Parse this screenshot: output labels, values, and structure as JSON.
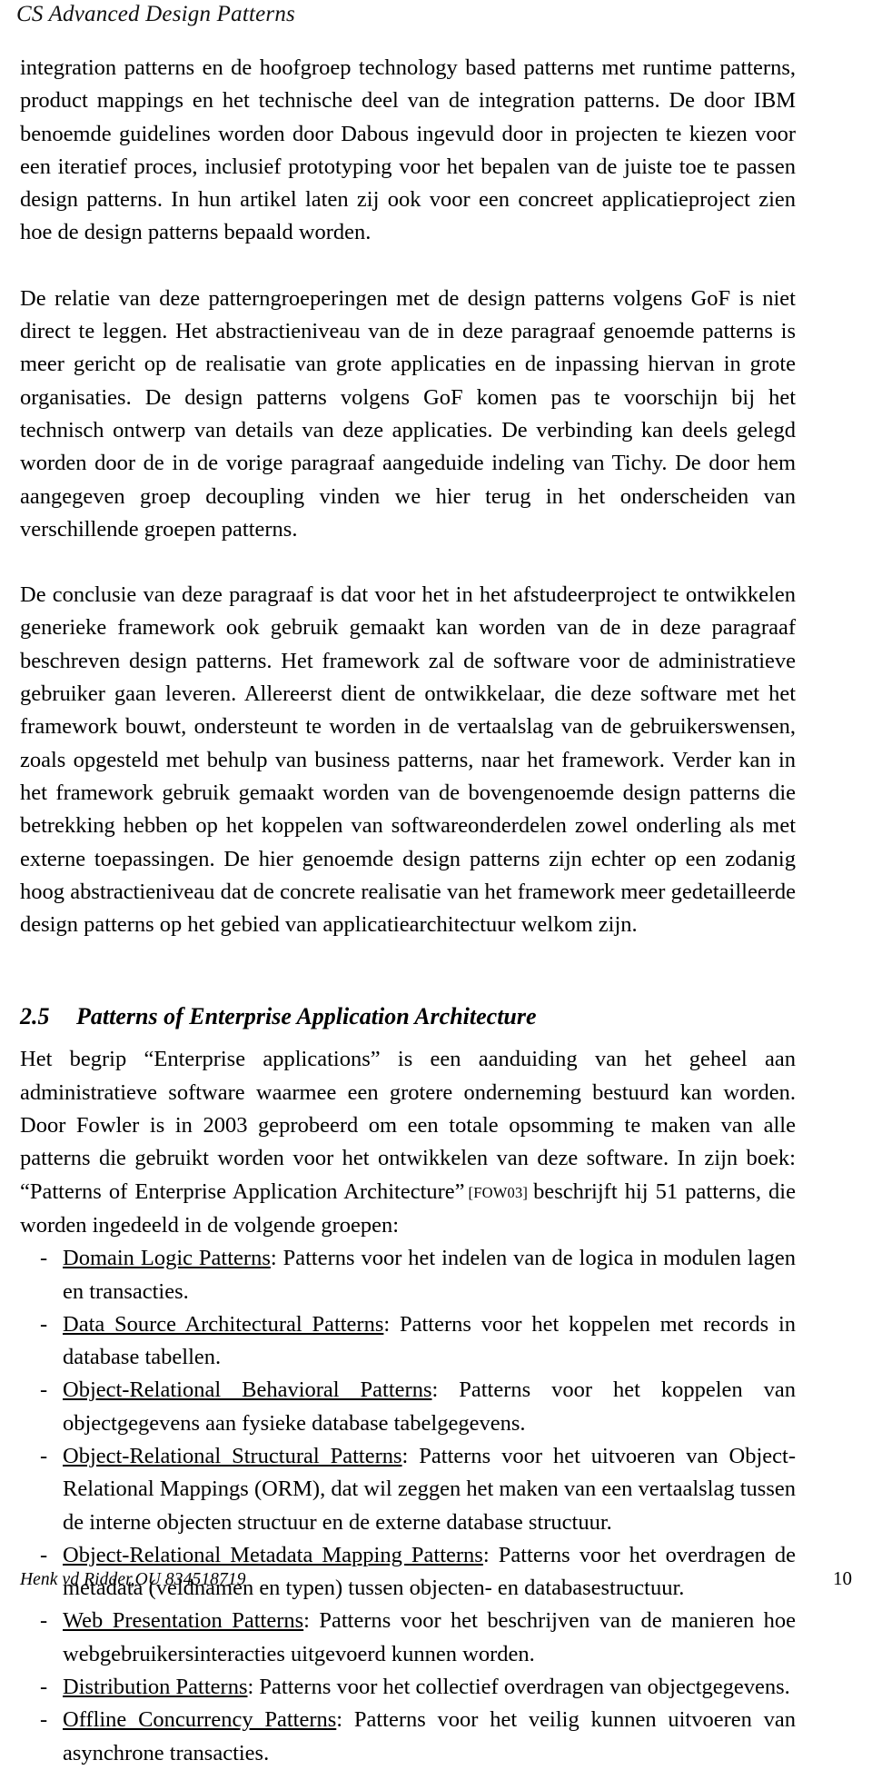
{
  "header": {
    "running_title": "CS Advanced Design Patterns"
  },
  "body": {
    "paragraph_1": "integration patterns en de hoofgroep technology based patterns met runtime patterns, product mappings en het technische deel van de integration patterns. De door IBM benoemde guidelines worden door Dabous ingevuld door in projecten te kiezen voor een iteratief proces, inclusief prototyping voor het bepalen van de juiste toe te passen design patterns. In hun artikel laten zij ook voor een concreet applicatieproject zien hoe de design patterns bepaald worden.",
    "paragraph_2": "De relatie van deze patterngroeperingen met de design patterns volgens GoF is niet direct te leggen. Het abstractieniveau van de in deze paragraaf genoemde patterns is meer gericht op de realisatie van grote applicaties en de inpassing hiervan in grote organisaties. De design patterns volgens GoF komen pas te voorschijn bij het technisch ontwerp van details van deze applicaties. De verbinding kan deels gelegd worden door de in de vorige paragraaf aangeduide indeling van Tichy. De door hem aangegeven groep decoupling vinden we hier terug in het onderscheiden van verschillende groepen patterns.",
    "paragraph_3": "De conclusie van deze paragraaf is dat voor het in het afstudeerproject te ontwikkelen generieke framework ook gebruik gemaakt kan worden van de in deze paragraaf beschreven design patterns. Het framework zal de software voor de administratieve gebruiker gaan leveren. Allereerst dient de ontwikkelaar, die deze software met het framework bouwt, ondersteunt te worden in de vertaalslag van de gebruikerswensen, zoals opgesteld met behulp van business patterns, naar het framework. Verder kan in het framework gebruik gemaakt worden van de bovengenoemde design patterns die betrekking hebben op het koppelen van softwareonderdelen zowel onderling als met externe toepassingen. De hier genoemde design patterns zijn echter op een zodanig hoog abstractieniveau dat de concrete realisatie van het framework meer gedetailleerde design patterns op het gebied van applicatiearchitectuur welkom zijn."
  },
  "section": {
    "number": "2.5",
    "title": "Patterns of Enterprise Application Architecture",
    "intro_part_1": "Het begrip “Enterprise applications” is een aanduiding van het geheel aan administratieve software waarmee een grotere onderneming bestuurd kan worden. Door Fowler is in 2003 geprobeerd om een totale opsomming te maken van alle patterns die gebruikt worden voor het ontwikkelen van deze software. In zijn boek: “Patterns of Enterprise Application Architecture”",
    "citation": "[FOW03]",
    "intro_part_2": "beschrijft hij 51 patterns, die worden ingedeeld in de volgende groepen:"
  },
  "list": {
    "items": [
      {
        "bullet": "-",
        "term": "Domain Logic Patterns",
        "text": ": Patterns voor het indelen van de logica in modulen lagen en transacties."
      },
      {
        "bullet": "-",
        "term": "Data Source Architectural Patterns",
        "text": ": Patterns voor het koppelen met records in database tabellen."
      },
      {
        "bullet": "-",
        "term": "Object-Relational Behavioral Patterns",
        "text": ": Patterns voor het koppelen van objectgegevens aan fysieke database tabelgegevens."
      },
      {
        "bullet": "-",
        "term": "Object-Relational Structural Patterns",
        "text": ": Patterns voor het uitvoeren van Object-Relational Mappings (ORM), dat wil zeggen het maken van een vertaalslag tussen de interne objecten structuur en de externe database structuur."
      },
      {
        "bullet": "-",
        "term": "Object-Relational Metadata Mapping Patterns",
        "text": ": Patterns voor het overdragen de metadata (veldnamen en typen) tussen objecten- en databasestructuur."
      },
      {
        "bullet": "-",
        "term": "Web Presentation Patterns",
        "text": ": Patterns voor het beschrijven van de manieren hoe webgebruikersinteracties uitgevoerd kunnen worden."
      },
      {
        "bullet": "-",
        "term": "Distribution Patterns",
        "text": ": Patterns voor het collectief overdragen van objectgegevens."
      },
      {
        "bullet": "-",
        "term": "Offline Concurrency Patterns",
        "text": ": Patterns voor het veilig kunnen uitvoeren van asynchrone transacties."
      }
    ]
  },
  "footer": {
    "author": "Henk vd Ridder,OU  834518719",
    "page_number": "10"
  }
}
